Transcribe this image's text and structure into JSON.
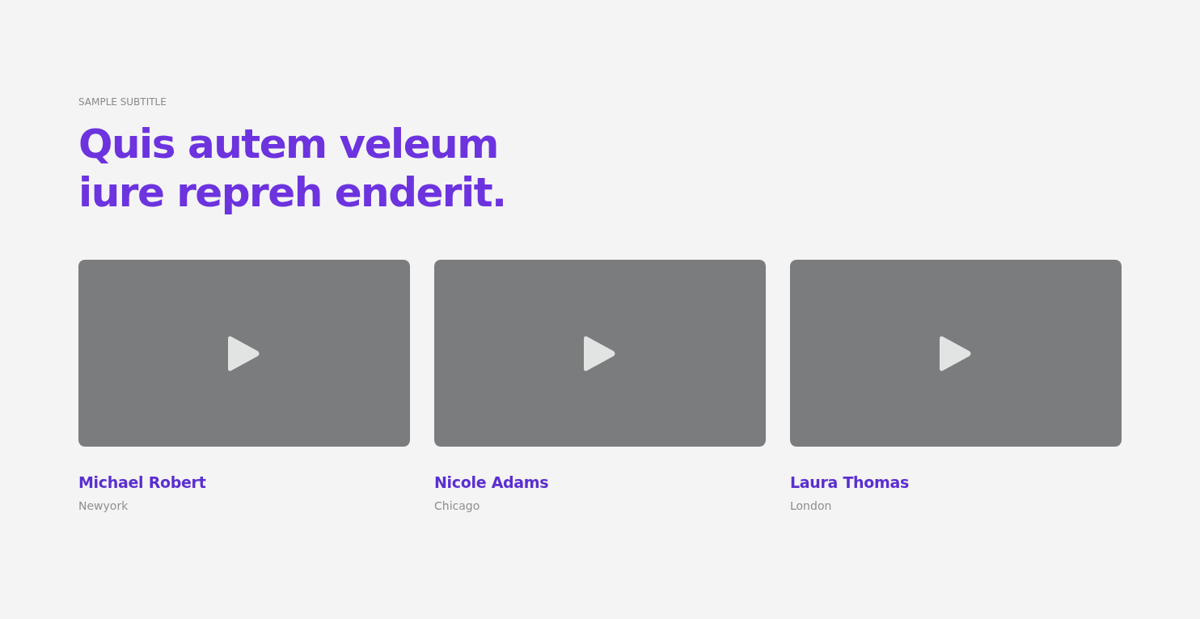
{
  "section": {
    "subtitle": "SAMPLE SUBTITLE",
    "heading": "Quis autem veleum iure repreh enderit."
  },
  "videos": [
    {
      "name": "Michael Robert",
      "city": "Newyork"
    },
    {
      "name": "Nicole Adams",
      "city": "Chicago"
    },
    {
      "name": "Laura Thomas",
      "city": "London"
    }
  ]
}
